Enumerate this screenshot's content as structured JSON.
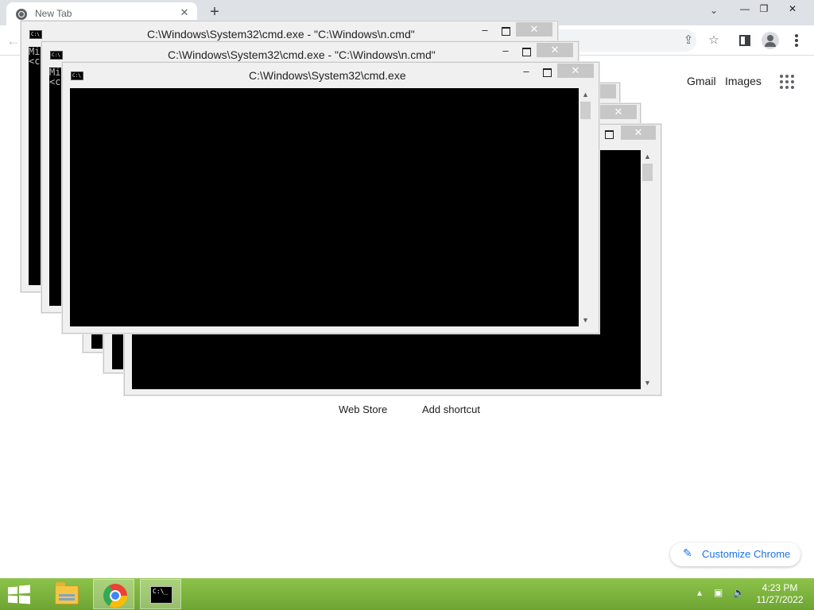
{
  "browser": {
    "tab_title": "New Tab",
    "tab_close": "✕",
    "new_tab": "+",
    "tab_search": "⌄",
    "window_min": "—",
    "window_restore": "❐",
    "window_close": "✕",
    "back": "←",
    "icons": [
      "chrome-logo-icon",
      "share-icon",
      "star-icon",
      "side-panel-icon",
      "profile-icon",
      "kebab-menu-icon"
    ]
  },
  "ntp": {
    "gmail": "Gmail",
    "images": "Images",
    "shortcuts": [
      "Web Store",
      "Add shortcut"
    ],
    "customize": "Customize Chrome"
  },
  "cmd_windows": [
    {
      "title": "C:\\Windows\\System32\\cmd.exe - \"C:\\Windows\\n.cmd\"",
      "console_text": "Mi\n<c"
    },
    {
      "title": "C:\\Windows\\System32\\cmd.exe - \"C:\\Windows\\n.cmd\"",
      "console_text": "Mi\n<c"
    },
    {
      "title": "C:\\Windows\\System32\\cmd.exe",
      "console_text": ""
    }
  ],
  "cmd_controls": {
    "minimize": "–",
    "close": "✕"
  },
  "taskbar": {
    "apps": [
      "file-explorer",
      "google-chrome",
      "command-prompt"
    ],
    "active_app": "google-chrome",
    "tray_icons": [
      "show-hidden-icons",
      "network-icon",
      "volume-icon"
    ],
    "time": "4:23 PM",
    "date": "11/27/2022"
  },
  "colors": {
    "taskbar": "#7cb342",
    "tabstrip": "#dee1e6",
    "accent": "#1a73e8",
    "console": "#000000"
  }
}
